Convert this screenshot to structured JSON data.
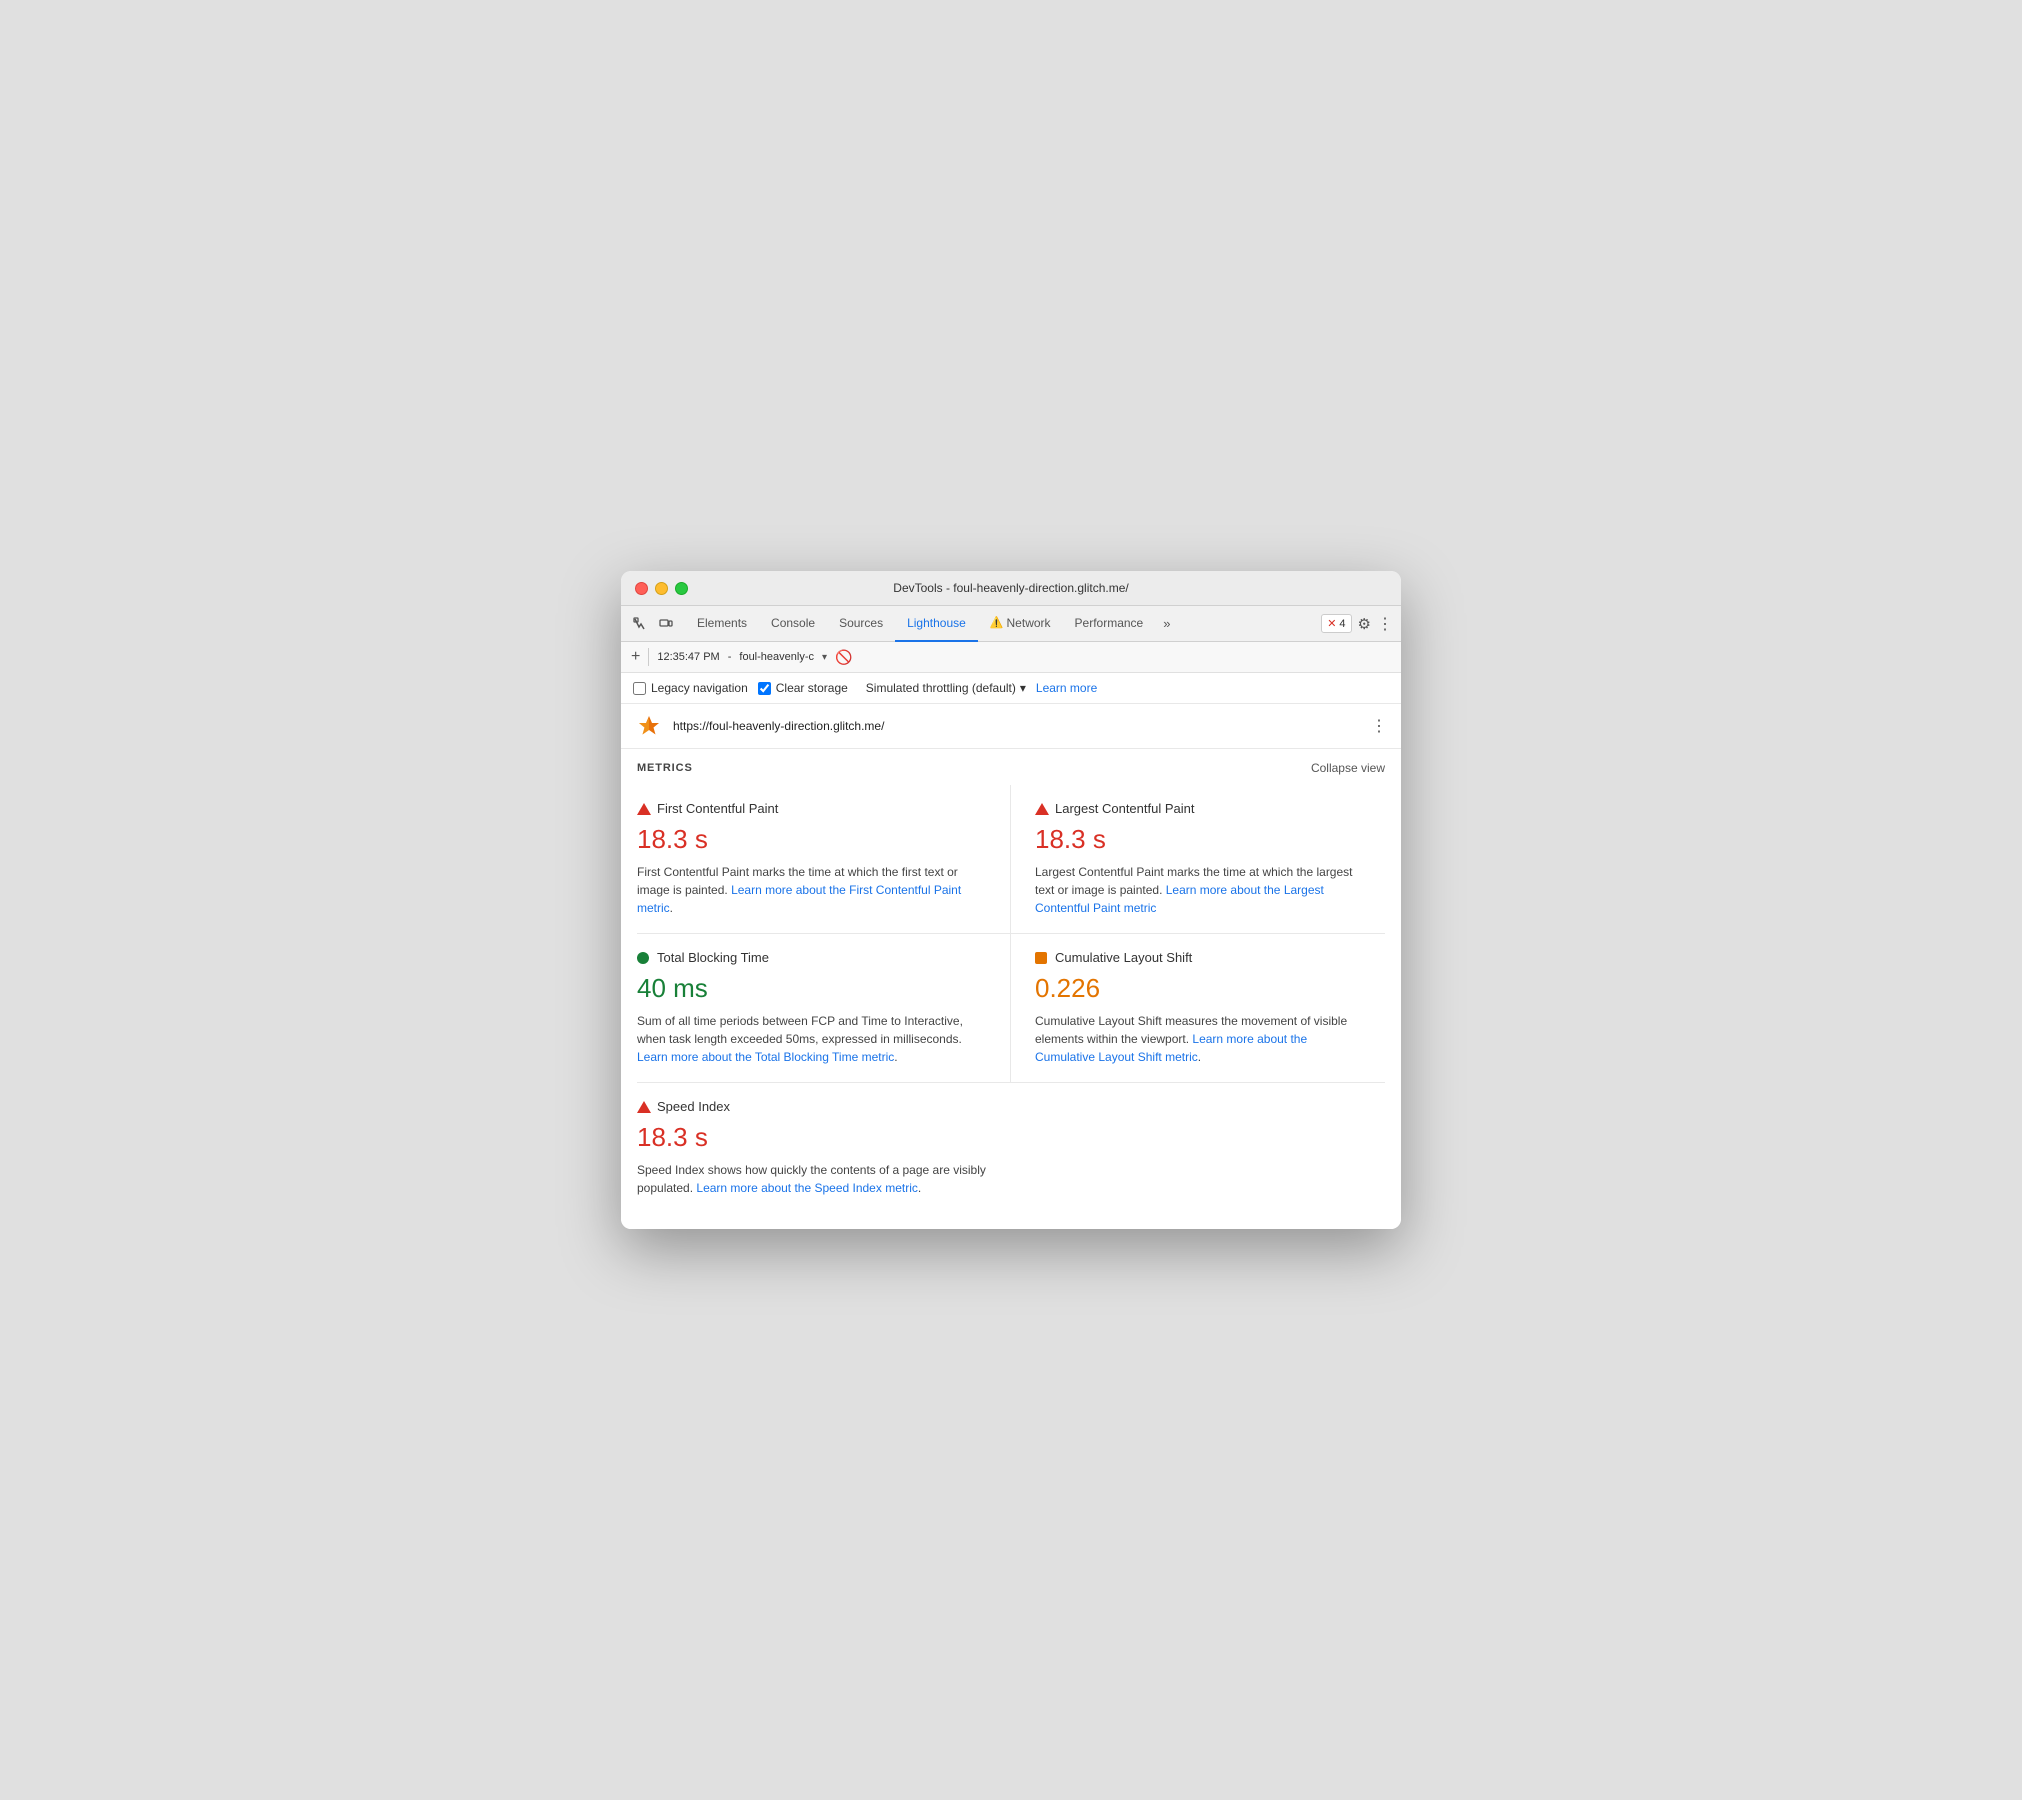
{
  "window": {
    "title": "DevTools - foul-heavenly-direction.glitch.me/"
  },
  "tabs": {
    "elements": "Elements",
    "console": "Console",
    "sources": "Sources",
    "lighthouse": "Lighthouse",
    "network": "Network",
    "performance": "Performance",
    "more": "»",
    "error_count": "4",
    "gear": "⚙",
    "more_vert": "⋮"
  },
  "toolbar": {
    "add": "+",
    "time": "12:35:47 PM",
    "url_short": "foul-heavenly-c",
    "dropdown": "▾",
    "stop_icon": "🚫"
  },
  "options": {
    "legacy_nav_label": "Legacy navigation",
    "clear_storage_label": "Clear storage",
    "throttle_label": "Simulated throttling (default)",
    "throttle_dropdown": "▾",
    "learn_more": "Learn more"
  },
  "url_bar": {
    "url": "https://foul-heavenly-direction.glitch.me/",
    "more_vert": "⋮"
  },
  "metrics": {
    "section_label": "METRICS",
    "collapse_label": "Collapse view",
    "items": [
      {
        "id": "fcp",
        "indicator": "red-triangle",
        "name": "First Contentful Paint",
        "value": "18.3 s",
        "value_color": "red",
        "description": "First Contentful Paint marks the time at which the first text or image is painted.",
        "link_text": "Learn more about the First Contentful Paint metric",
        "link_href": "#"
      },
      {
        "id": "lcp",
        "indicator": "red-triangle",
        "name": "Largest Contentful Paint",
        "value": "18.3 s",
        "value_color": "red",
        "description": "Largest Contentful Paint marks the time at which the largest text or image is painted.",
        "link_text": "Learn more about the Largest Contentful Paint metric",
        "link_href": "#"
      },
      {
        "id": "tbt",
        "indicator": "green-circle",
        "name": "Total Blocking Time",
        "value": "40 ms",
        "value_color": "green",
        "description": "Sum of all time periods between FCP and Time to Interactive, when task length exceeded 50ms, expressed in milliseconds.",
        "link_text": "Learn more about the Total Blocking Time metric",
        "link_href": "#"
      },
      {
        "id": "cls",
        "indicator": "orange-square",
        "name": "Cumulative Layout Shift",
        "value": "0.226",
        "value_color": "orange",
        "description": "Cumulative Layout Shift measures the movement of visible elements within the viewport.",
        "link_text": "Learn more about the Cumulative Layout Shift metric",
        "link_href": "#"
      },
      {
        "id": "si",
        "indicator": "red-triangle",
        "name": "Speed Index",
        "value": "18.3 s",
        "value_color": "red",
        "description": "Speed Index shows how quickly the contents of a page are visibly populated.",
        "link_text": "Learn more about the Speed Index metric",
        "link_href": "#"
      }
    ]
  }
}
